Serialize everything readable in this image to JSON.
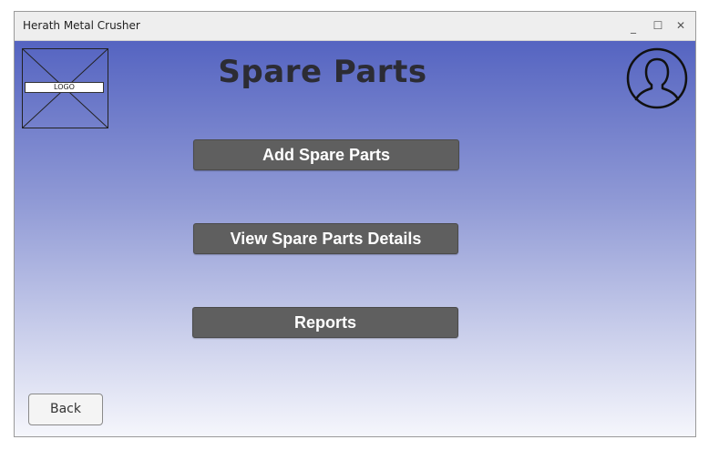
{
  "window": {
    "title": "Herath Metal Crusher",
    "minimize_glyph": "_",
    "maximize_glyph": "☐",
    "close_glyph": "✕"
  },
  "header": {
    "logo_text": "LOGO",
    "page_title": "Spare Parts",
    "avatar_icon": "user-profile-icon"
  },
  "menu": {
    "add_label": "Add Spare Parts",
    "view_label": "View Spare Parts Details",
    "reports_label": "Reports"
  },
  "footer": {
    "back_label": "Back"
  },
  "colors": {
    "gradient_top": "#5564c1",
    "gradient_bottom": "#f6f7fc",
    "button_bg": "#5f5f5f",
    "button_text": "#ffffff",
    "title_text": "#2c2c34"
  }
}
